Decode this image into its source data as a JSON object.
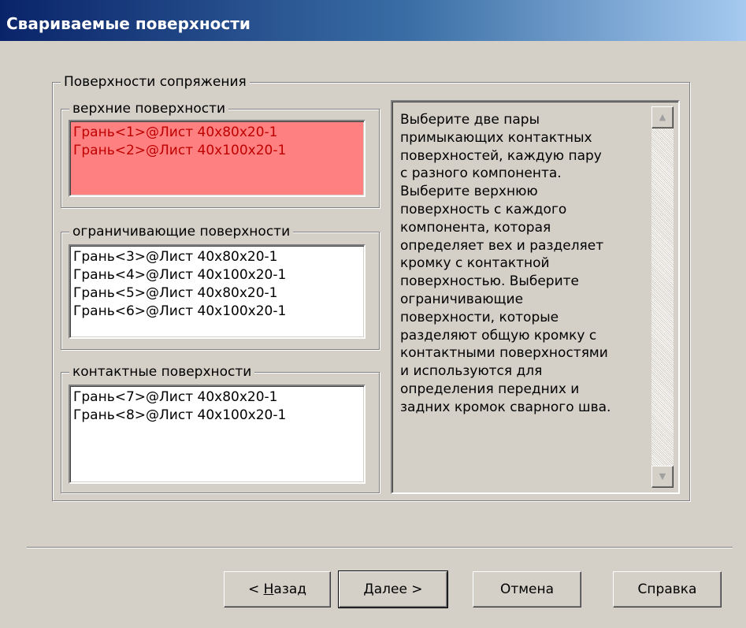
{
  "window": {
    "title": "Свариваемые поверхности"
  },
  "mating_group": {
    "label": "Поверхности сопряжения"
  },
  "top_faces": {
    "label": "верхние поверхности",
    "items": [
      "Грань<1>@Лист 40x80x20-1",
      "Грань<2>@Лист 40x100x20-1"
    ]
  },
  "bounding_faces": {
    "label": "ограничивающие поверхности",
    "items": [
      "Грань<3>@Лист 40x80x20-1",
      "Грань<4>@Лист 40x100x20-1",
      "Грань<5>@Лист 40x80x20-1",
      "Грань<6>@Лист 40x100x20-1"
    ]
  },
  "contact_faces": {
    "label": "контактные поверхности",
    "items": [
      "Грань<7>@Лист 40x80x20-1",
      "Грань<8>@Лист 40x100x20-1"
    ]
  },
  "help": {
    "lines": [
      "Выберите две пары",
      "примыкающих контактных",
      "поверхностей, каждую пару",
      "с разного компонента.",
      "Выберите верхнюю",
      "поверхность с каждого",
      "компонента, которая",
      "определяет вех и разделяет",
      "кромку с контактной",
      "поверхностью. Выберите",
      "ограничивающие",
      "поверхности, которые",
      "разделяют общую кромку с",
      "контактными поверхностями",
      "и используются для",
      "определения передних и",
      "задних кромок сварного шва."
    ]
  },
  "buttons": {
    "back_prefix": "< ",
    "back_accel": "Н",
    "back_rest": "азад",
    "next_accel": "Д",
    "next_rest": "алее >",
    "cancel": "Отмена",
    "help": "Справка"
  },
  "icons": {
    "scroll_up": "scroll-up-arrow-icon",
    "scroll_down": "scroll-down-arrow-icon"
  },
  "colors": {
    "active_list_bg": "#ff8080",
    "active_list_text": "#c00000"
  }
}
